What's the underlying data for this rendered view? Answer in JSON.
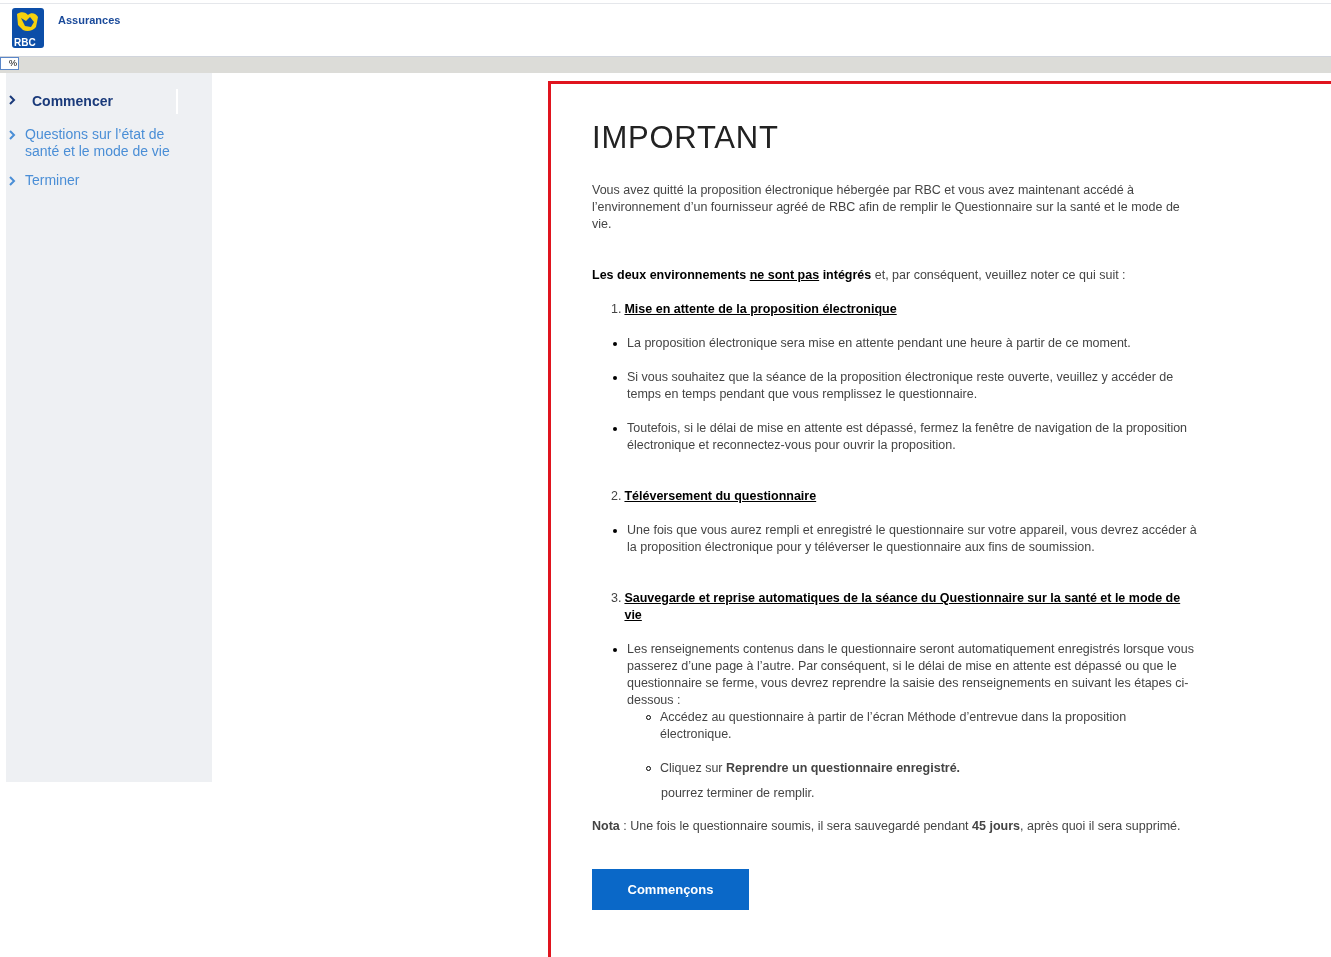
{
  "header": {
    "logo_text": "RBC",
    "brand": "Assurances"
  },
  "progress": {
    "label": "%",
    "level": 0
  },
  "sidebar": {
    "items": [
      {
        "label": "Commencer",
        "selected": true
      },
      {
        "label": "Questions sur l’état de santé et le mode de vie",
        "selected": false
      },
      {
        "label": "Terminer",
        "selected": false
      }
    ]
  },
  "content": {
    "title": "IMPORTANT",
    "intro": "Vous avez quitté la proposition électronique hébergée par RBC et vous avez maintenant accédé à l’environnement d’un fournisseur agréé de RBC afin de remplir le Questionnaire sur la santé et le mode de vie.",
    "lead": [
      {
        "text": "Les deux environnements ",
        "bold": true,
        "underline": false
      },
      {
        "text": "ne sont pas",
        "bold": true,
        "underline": true
      },
      {
        "text": " intégrés",
        "bold": true,
        "underline": false
      },
      {
        "text": " et, par conséquent, veuillez noter ce qui suit :",
        "bold": false,
        "underline": false
      }
    ],
    "sections": [
      {
        "number": "1.",
        "heading": "Mise en attente de la proposition électronique",
        "bullets": [
          {
            "text": "La proposition électronique sera mise en attente pendant une heure à partir de ce moment."
          },
          {
            "text": "Si vous souhaitez que la séance de la proposition électronique reste ouverte, veuillez y accéder de temps en temps pendant que vous remplissez le questionnaire."
          },
          {
            "text": "Toutefois, si le délai de mise en attente est dépassé, fermez la fenêtre de navigation de la proposition électronique et reconnectez-vous pour ouvrir la proposition."
          }
        ]
      },
      {
        "number": "2.",
        "heading": "Téléversement du questionnaire",
        "bullets": [
          {
            "text": "Une fois que vous aurez rempli et enregistré le questionnaire sur votre appareil, vous devrez accéder à la proposition électronique pour y téléverser le questionnaire aux fins de soumission."
          }
        ]
      },
      {
        "number": "3.",
        "heading": "Sauvegarde et reprise automatiques de la séance du Questionnaire sur la santé et le mode de vie",
        "bullets": [
          {
            "text": "Les renseignements contenus dans le questionnaire seront automatiquement enregistrés lorsque vous passerez d’une page à l’autre. Par conséquent, si le délai de mise en attente est dépassé ou que le questionnaire se ferme, vous devrez reprendre la saisie des renseignements en suivant les étapes ci-dessous :",
            "subitems": [
              "Accédez au questionnaire à partir de l’écran Méthode d’entrevue dans la proposition électronique.",
              "Cliquez sur **Reprendre un questionnaire enregistré.**"
            ],
            "fragment": "pourrez terminer de remplir."
          }
        ]
      }
    ],
    "nota": "**Nota** : Une fois le questionnaire soumis, il sera sauvegardé pendant **45 jours**, après quoi il sera supprimé.",
    "button": "Commençons"
  }
}
